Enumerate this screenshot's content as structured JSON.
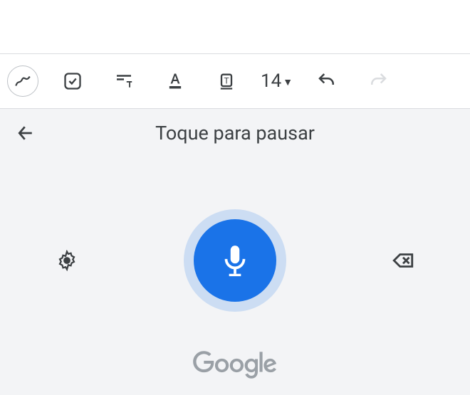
{
  "toolbar": {
    "font_size": "14"
  },
  "voice": {
    "title": "Toque para pausar"
  },
  "brand": {
    "name": "Google"
  }
}
